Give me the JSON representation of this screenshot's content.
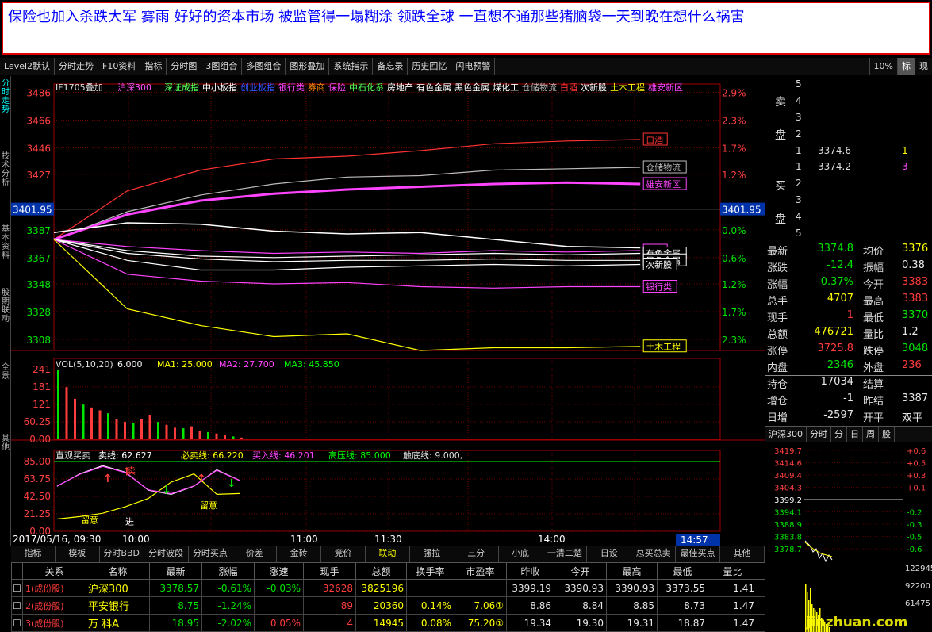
{
  "banner": {
    "text": "保险也加入杀跌大军  雾雨 好好的资本市场 被监管得一塌糊涂 领跌全球 一直想不通那些猪脑袋一天到晚在想什么祸害"
  },
  "toolbar": {
    "items": [
      "Level2默认",
      "分时走势",
      "F10资料",
      "指标",
      "分时图",
      "3图组合",
      "多图组合",
      "图形叠加",
      "系统指示",
      "备忘录",
      "历史回忆",
      "闪电预警"
    ],
    "right": [
      "10%",
      "标",
      "现"
    ]
  },
  "left_tabs": [
    "分时走势",
    "技术分析",
    "基本资料",
    "股期联动",
    "全景",
    "其他"
  ],
  "chart": {
    "contract": "IF1705叠加",
    "overlays": [
      {
        "name": "沪深300",
        "color": "#ff55ff"
      },
      {
        "name": "深证成指",
        "color": "#55ff55"
      },
      {
        "name": "中小板指",
        "color": "#ffffff"
      },
      {
        "name": "创业板指",
        "color": "#3355ff"
      },
      {
        "name": "银行类",
        "color": "#ff44ff"
      },
      {
        "name": "券商",
        "color": "#ff8800"
      },
      {
        "name": "保险",
        "color": "#ff44ff"
      },
      {
        "name": "中石化系",
        "color": "#55ff55"
      },
      {
        "name": "房地产",
        "color": "#ffffff"
      },
      {
        "name": "有色金属",
        "color": "#ffffff"
      },
      {
        "name": "黑色金属",
        "color": "#ffffff"
      },
      {
        "name": "煤化工",
        "color": "#ffffff"
      },
      {
        "name": "仓储物流",
        "color": "#bbbbbb"
      },
      {
        "name": "白酒",
        "color": "#ff3333"
      },
      {
        "name": "次新股",
        "color": "#ffffff"
      },
      {
        "name": "土木工程",
        "color": "#ffff00"
      },
      {
        "name": "雄安新区",
        "color": "#ff44ff"
      }
    ],
    "left_axis": [
      "3486",
      "3466",
      "3446",
      "3427",
      "3401.95",
      "3387",
      "3367",
      "3348",
      "3328",
      "3308"
    ],
    "right_axis": [
      "2.9%",
      "2.3%",
      "1.7%",
      "1.2%",
      "3401.95",
      "0.0%",
      "0.6%",
      "1.2%",
      "1.7%",
      "2.3%"
    ],
    "line_labels": [
      "白酒",
      "仓储物流",
      "雄安新区",
      "保险",
      "有色金属",
      "黑色金属",
      "次新股",
      "银行类",
      "土木工程"
    ],
    "vol_header": {
      "prefix": "VOL(5,10,20)",
      "v1": "6.000",
      "ma1": "MA1: 25.000",
      "ma2": "MA2: 27.700",
      "ma3": "MA3: 45.850"
    },
    "vol_axis": [
      "241",
      "181",
      "121",
      "60.25",
      "0.00"
    ],
    "ind_header": {
      "name": "直观买卖",
      "sell": "卖线: 62.627",
      "must": "必卖线: 66.220",
      "buy": "买入线: 46.201",
      "high": "高压线: 85.000",
      "bottom": "触底线: 9.000,"
    },
    "ind_axis": [
      "85.00",
      "63.75",
      "42.50",
      "21.25",
      "0.00"
    ],
    "ind_labels": {
      "caution": "留意",
      "enter": "进",
      "up": "↑",
      "down": "↓",
      "caution2": "留意",
      "sell_mark": "卖"
    },
    "time_axis": {
      "date": "2017/05/16, 09:30",
      "t1": "10:00",
      "t2": "11:00",
      "t3": "11:30",
      "t4": "14:00",
      "cur": "14:57"
    }
  },
  "chart_data": {
    "type": "line",
    "xlabel": "",
    "ylabel": "",
    "x": [
      "09:30",
      "10:00",
      "10:30",
      "11:00",
      "11:30",
      "13:30",
      "14:00",
      "14:30",
      "14:57"
    ],
    "ylim": [
      3300,
      3492
    ],
    "series": [
      {
        "name": "白酒",
        "values": [
          3380,
          3415,
          3430,
          3438,
          3440,
          3444,
          3449,
          3451,
          3452
        ]
      },
      {
        "name": "仓储物流",
        "values": [
          3380,
          3400,
          3412,
          3420,
          3425,
          3426,
          3430,
          3431,
          3432
        ]
      },
      {
        "name": "雄安新区",
        "values": [
          3380,
          3398,
          3408,
          3413,
          3416,
          3418,
          3420,
          3421,
          3420
        ]
      },
      {
        "name": "保险",
        "values": [
          3380,
          3375,
          3372,
          3370,
          3371,
          3370,
          3372,
          3371,
          3372
        ]
      },
      {
        "name": "有色金属",
        "values": [
          3380,
          3372,
          3368,
          3367,
          3368,
          3369,
          3370,
          3369,
          3370
        ]
      },
      {
        "name": "黑色金属",
        "values": [
          3380,
          3370,
          3366,
          3364,
          3365,
          3365,
          3366,
          3365,
          3365
        ]
      },
      {
        "name": "次新股",
        "values": [
          3380,
          3365,
          3358,
          3358,
          3360,
          3361,
          3362,
          3361,
          3362
        ]
      },
      {
        "name": "银行类",
        "values": [
          3380,
          3355,
          3350,
          3348,
          3349,
          3346,
          3345,
          3346,
          3346
        ]
      },
      {
        "name": "土木工程",
        "values": [
          3380,
          3330,
          3318,
          3310,
          3312,
          3300,
          3302,
          3302,
          3303
        ]
      },
      {
        "name": "IF1705",
        "values": [
          3385,
          3392,
          3391,
          3386,
          3384,
          3385,
          3380,
          3375,
          3374
        ]
      }
    ],
    "volume": [
      241,
      180,
      140,
      120,
      110,
      100,
      90,
      70,
      60,
      55,
      70,
      85,
      60,
      50,
      40,
      38,
      45,
      30,
      25,
      20,
      15,
      10,
      6
    ],
    "indicator_sell": [
      55,
      70,
      80,
      72,
      50,
      45,
      55,
      75,
      62
    ],
    "indicator_buy": [
      15,
      18,
      22,
      30,
      40,
      60,
      70,
      45,
      46
    ]
  },
  "ticker": [
    "指标",
    "模板",
    "分时BBD",
    "分时波段",
    "分时买点",
    "价差",
    "金砖",
    "竞价",
    "联动",
    "强拉",
    "三分",
    "小底",
    "一清二楚",
    "日设",
    "总买总卖",
    "最佳买点",
    "其他"
  ],
  "table": {
    "headers": [
      "",
      "关系",
      "名称",
      "最新",
      "涨幅",
      "涨速",
      "现手",
      "总额",
      "换手率",
      "市盈率",
      "昨收",
      "今开",
      "最高",
      "最低",
      "量比",
      ""
    ],
    "rows": [
      {
        "no": "1",
        "rel": "(成份股)",
        "name": "沪深300",
        "last": "3378.57",
        "chg": "-0.61%",
        "speed": "-0.03%",
        "hand": "32628",
        "amt": "3825196",
        "turn": "",
        "pe": "",
        "prev": "3399.19",
        "open": "3390.93",
        "high": "3390.93",
        "low": "3373.55",
        "vr": "1.41"
      },
      {
        "no": "2",
        "rel": "(成份股)",
        "name": "平安银行",
        "last": "8.75",
        "chg": "-1.24%",
        "speed": "",
        "hand": "89",
        "amt": "20360",
        "turn": "0.14%",
        "pe": "7.06①",
        "prev": "8.86",
        "open": "8.84",
        "high": "8.85",
        "low": "8.73",
        "vr": "1.47"
      },
      {
        "no": "3",
        "rel": "(成份股)",
        "name": "万 科A",
        "last": "18.95",
        "chg": "-2.02%",
        "speed": "0.05%",
        "hand": "4",
        "amt": "14945",
        "turn": "0.08%",
        "pe": "75.20①",
        "prev": "19.34",
        "open": "19.30",
        "high": "19.31",
        "low": "18.87",
        "vr": "1.47"
      }
    ]
  },
  "orderbook": {
    "sell_label": [
      "卖",
      "盘"
    ],
    "buy_label": [
      "买",
      "盘"
    ],
    "sell": [
      {
        "lv": "5",
        "p": "",
        "v": ""
      },
      {
        "lv": "4",
        "p": "",
        "v": ""
      },
      {
        "lv": "3",
        "p": "",
        "v": ""
      },
      {
        "lv": "2",
        "p": "",
        "v": ""
      },
      {
        "lv": "1",
        "p": "3374.6",
        "v": "1"
      }
    ],
    "buy": [
      {
        "lv": "1",
        "p": "3374.2",
        "v": "3"
      },
      {
        "lv": "2",
        "p": "",
        "v": ""
      },
      {
        "lv": "3",
        "p": "",
        "v": ""
      },
      {
        "lv": "4",
        "p": "",
        "v": ""
      },
      {
        "lv": "5",
        "p": "",
        "v": ""
      }
    ]
  },
  "quote": [
    {
      "k": "最新",
      "v": "3374.8",
      "vc": "#00e600",
      "k2": "均价",
      "v2": "3376",
      "v2c": "#ffff00"
    },
    {
      "k": "涨跌",
      "v": "-12.4",
      "vc": "#00e600",
      "k2": "振幅",
      "v2": "0.38",
      "v2c": "#e8e8e8"
    },
    {
      "k": "涨幅",
      "v": "-0.37%",
      "vc": "#00e600",
      "k2": "今开",
      "v2": "3383",
      "v2c": "#ff3c3c"
    },
    {
      "k": "总手",
      "v": "4707",
      "vc": "#ffff00",
      "k2": "最高",
      "v2": "3383",
      "v2c": "#ff3c3c"
    },
    {
      "k": "现手",
      "v": "1",
      "vc": "#ff3c3c",
      "k2": "最低",
      "v2": "3370",
      "v2c": "#00e600"
    },
    {
      "k": "总额",
      "v": "476721",
      "vc": "#ffff00",
      "k2": "量比",
      "v2": "1.2",
      "v2c": "#e8e8e8"
    },
    {
      "k": "涨停",
      "v": "3725.8",
      "vc": "#ff3c3c",
      "k2": "跌停",
      "v2": "3048",
      "v2c": "#00e600"
    },
    {
      "k": "内盘",
      "v": "2346",
      "vc": "#00e600",
      "k2": "外盘",
      "v2": "236",
      "v2c": "#ff3c3c"
    },
    {
      "k": "持仓",
      "v": "17034",
      "vc": "#e8e8e8",
      "k2": "结算",
      "v2": "",
      "v2c": "#e8e8e8"
    },
    {
      "k": "增仓",
      "v": "-1",
      "vc": "#e8e8e8",
      "k2": "昨结",
      "v2": "3387",
      "v2c": "#e8e8e8"
    },
    {
      "k": "日增",
      "v": "-2597",
      "vc": "#e8e8e8",
      "k2": "开平",
      "v2": "双平",
      "v2c": "#e8e8e8"
    }
  ],
  "mini": {
    "tabs": [
      "沪深300",
      "分时",
      "分",
      "日",
      "周",
      "股"
    ],
    "axis": [
      "3419.7",
      "3414.6",
      "3409.4",
      "3404.3",
      "3399.2",
      "3394.1",
      "3388.9",
      "3383.8",
      "3378.7"
    ],
    "raxis": [
      "+0.6",
      "+0.5",
      "+0.3",
      "+0.1",
      "",
      "-0.2",
      "-0.3",
      "-0.5",
      "-0.6"
    ],
    "vol": [
      "122945",
      "92200",
      "61475"
    ],
    "watermark": "jinzhuan.com"
  }
}
